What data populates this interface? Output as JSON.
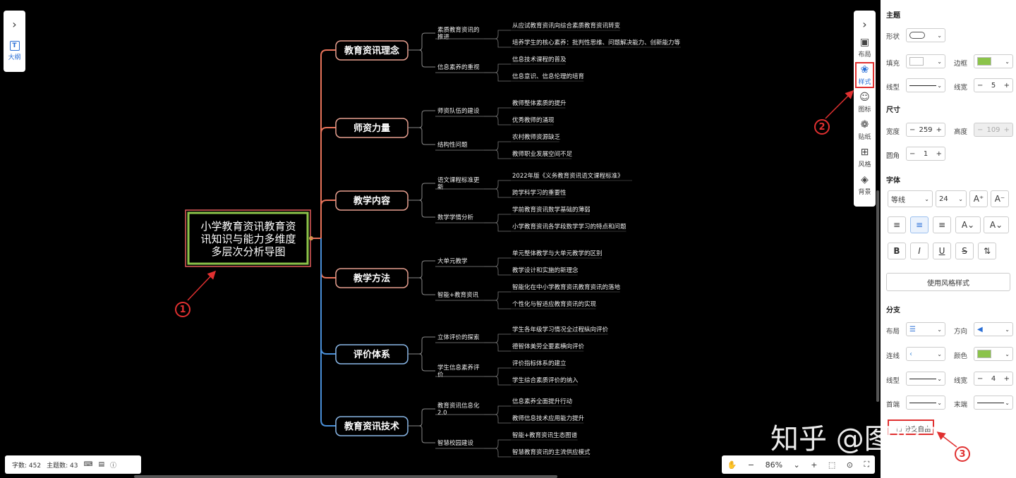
{
  "mindmap": {
    "root": "小学教育资讯教育资讯知识与能力多维度多层次分析导图",
    "root_lines": [
      "小学教育资讯教育资",
      "讯知识与能力多维度",
      "多层次分析导图"
    ],
    "branches": [
      {
        "label": "教育资讯理念",
        "children": [
          {
            "label": "素质教育资讯的推进",
            "lines": [
              "素质教育资讯的",
              "推进"
            ],
            "leaves": [
              "从应试教育资讯向综合素质教育资讯转变",
              "培养学生的核心素养：批判性思维、问题解决能力、创新能力等"
            ]
          },
          {
            "label": "信息素养的重视",
            "lines": [
              "信息素养的重视"
            ],
            "leaves": [
              "信息技术课程的普及",
              "信息意识、信息伦理的培育"
            ]
          }
        ]
      },
      {
        "label": "师资力量",
        "children": [
          {
            "label": "师资队伍的建设",
            "lines": [
              "师资队伍的建设"
            ],
            "leaves": [
              "教师整体素质的提升",
              "优秀教师的涌现"
            ]
          },
          {
            "label": "结构性问题",
            "lines": [
              "结构性问题"
            ],
            "leaves": [
              "农村教师资源缺乏",
              "教师职业发展空间不足"
            ]
          }
        ]
      },
      {
        "label": "教学内容",
        "children": [
          {
            "label": "语文课程标准更新",
            "lines": [
              "语文课程标准更",
              "新"
            ],
            "leaves": [
              "2022年版《义务教育资讯语文课程标准》",
              "跨学科学习的重要性"
            ]
          },
          {
            "label": "数学学情分析",
            "lines": [
              "数学学情分析"
            ],
            "leaves": [
              "学前教育资讯数学基础的薄弱",
              "小学教育资讯各学段数学学习的特点和问题"
            ]
          }
        ]
      },
      {
        "label": "教学方法",
        "children": [
          {
            "label": "大单元教学",
            "lines": [
              "大单元教学"
            ],
            "leaves": [
              "单元整体教学与大单元教学的区别",
              "教学设计和实施的新理念"
            ]
          },
          {
            "label": "智能+教育资讯",
            "lines": [
              "智能+教育资讯"
            ],
            "leaves": [
              "智能化在中小学教育资讯教育资讯的落地",
              "个性化与智适应教育资讯的实现"
            ]
          }
        ]
      },
      {
        "label": "评价体系",
        "children": [
          {
            "label": "立体评价的探索",
            "lines": [
              "立体评价的探索"
            ],
            "leaves": [
              "学生各年级学习情况全过程纵向评价",
              "德智体美劳全要素横向评价"
            ]
          },
          {
            "label": "学生信息素养评价",
            "lines": [
              "学生信息素养评",
              "价"
            ],
            "leaves": [
              "评价指标体系的建立",
              "学生综合素质评价的纳入"
            ]
          }
        ]
      },
      {
        "label": "教育资讯技术",
        "children": [
          {
            "label": "教育资讯信息化2.0",
            "lines": [
              "教育资讯信息化",
              "2.0"
            ],
            "leaves": [
              "信息素养全面提升行动",
              "教师信息技术应用能力提升"
            ]
          },
          {
            "label": "智慧校园建设",
            "lines": [
              "智慧校园建设"
            ],
            "leaves": [
              "智能+教育资讯生态图谱",
              "智慧教育资讯的主流供应模式"
            ]
          }
        ]
      }
    ],
    "colors": {
      "root_border": "#8bc34a",
      "root_outer": "#e05a5a",
      "branch_warm": "#e8735a",
      "branch_cool": "#4a90d9",
      "leaf_line": "#888888"
    }
  },
  "left_toolbar": {
    "outline_label": "大纲"
  },
  "right_toolbar": {
    "items": [
      {
        "icon": "layout-icon",
        "label": "布局"
      },
      {
        "icon": "palette-icon",
        "label": "样式"
      },
      {
        "icon": "smiley-icon",
        "label": "图标"
      },
      {
        "icon": "sticker-icon",
        "label": "贴纸"
      },
      {
        "icon": "style-grid-icon",
        "label": "风格"
      },
      {
        "icon": "layers-icon",
        "label": "背景"
      }
    ]
  },
  "status": {
    "words": "字数: 452",
    "topics": "主题数: 43"
  },
  "zoom": {
    "value": "86%"
  },
  "sidebar": {
    "topic_title": "主题",
    "shape_label": "形状",
    "fill_label": "填充",
    "border_label": "边框",
    "border_color": "#8bc34a",
    "linetype_label": "线型",
    "linewidth_label": "线宽",
    "linewidth_value": "5",
    "size_title": "尺寸",
    "width_label": "宽度",
    "width_value": "259",
    "height_label": "高度",
    "height_value": "109",
    "radius_label": "圆角",
    "radius_value": "1",
    "font_title": "字体",
    "font_family": "等线",
    "font_size": "24",
    "use_style_button": "使用风格样式",
    "branch_title": "分支",
    "layout_label": "布局",
    "direction_label": "方向",
    "connector_label": "连线",
    "color_label": "颜色",
    "branch_color": "#8bc34a",
    "branch_linetype_label": "线型",
    "branch_linewidth_label": "线宽",
    "branch_linewidth_value": "4",
    "head_label": "首端",
    "tail_label": "末端",
    "branch_free_label": "分支自由"
  },
  "annotations": [
    "1",
    "2",
    "3"
  ],
  "watermark": "知乎 @图形天下"
}
